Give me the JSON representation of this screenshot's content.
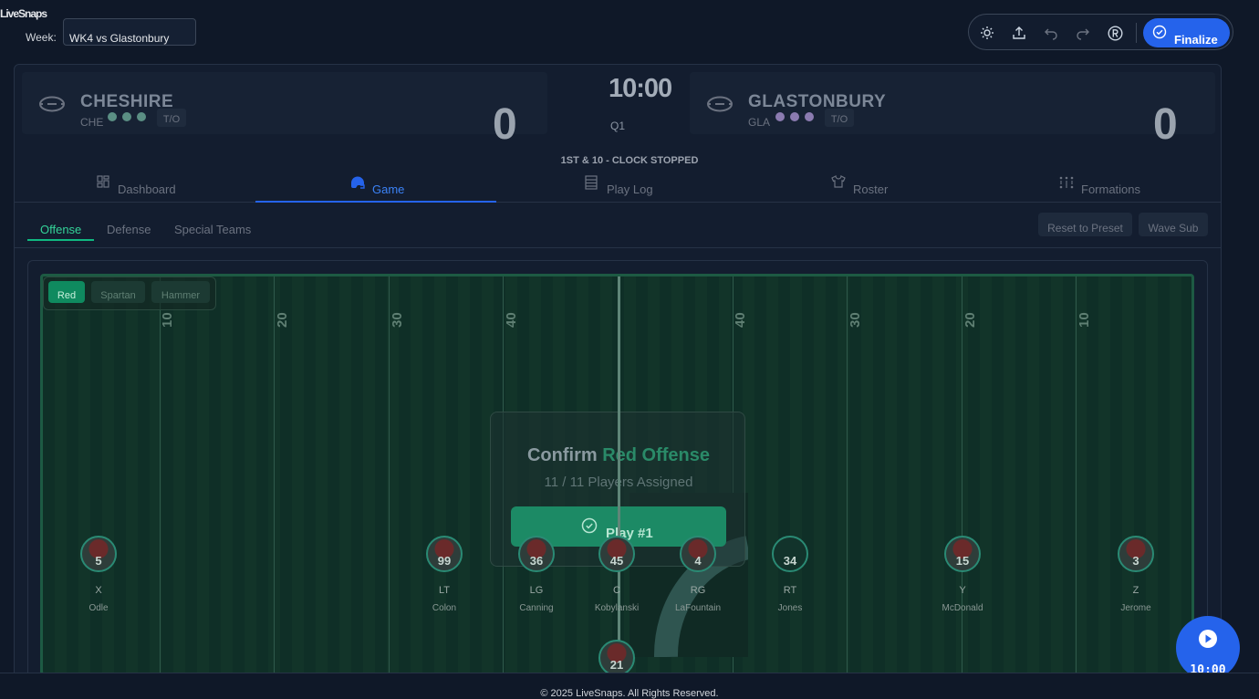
{
  "app": {
    "title": "LiveSnaps"
  },
  "week": {
    "label": "Week:",
    "value": "WK4 vs Glastonbury"
  },
  "toolbar": {
    "finalize_label": "Finalize"
  },
  "home": {
    "name": "CHESHIRE",
    "abbr": "CHE",
    "score": "0",
    "timeout_label": "T/O",
    "timeout_color": "#5b8f84"
  },
  "away": {
    "name": "GLASTONBURY",
    "abbr": "GLA",
    "score": "0",
    "timeout_label": "T/O",
    "timeout_color": "#8b7bb0"
  },
  "game_clock": "10:00",
  "quarter": "Q1",
  "down_distance": "1ST & 10 - CLOCK STOPPED",
  "tabs": [
    {
      "label": "Dashboard",
      "icon": "dashboard-icon"
    },
    {
      "label": "Game",
      "icon": "helmet-icon"
    },
    {
      "label": "Play Log",
      "icon": "log-icon"
    },
    {
      "label": "Roster",
      "icon": "jersey-icon"
    },
    {
      "label": "Formations",
      "icon": "formation-icon"
    }
  ],
  "active_tab": "Game",
  "units": [
    "Offense",
    "Defense",
    "Special Teams"
  ],
  "active_unit": "Offense",
  "actions": {
    "reset_label": "Reset to Preset",
    "wave_label": "Wave Sub"
  },
  "presets": [
    "Red",
    "Spartan",
    "Hammer"
  ],
  "active_preset": "Red",
  "yard_numbers": [
    "10",
    "20",
    "30",
    "40",
    "40",
    "30",
    "20",
    "10"
  ],
  "confirm": {
    "prefix": "Confirm",
    "accent": "Red Offense",
    "assigned": "11 / 11 Players Assigned",
    "button_label": "Play #1"
  },
  "players": [
    {
      "number": "5",
      "position": "X",
      "name": "Odle"
    },
    {
      "number": "99",
      "position": "LT",
      "name": "Colon"
    },
    {
      "number": "36",
      "position": "LG",
      "name": "Canning"
    },
    {
      "number": "45",
      "position": "C",
      "name": "Kobylanski"
    },
    {
      "number": "4",
      "position": "RG",
      "name": "LaFountain"
    },
    {
      "number": "34",
      "position": "RT",
      "name": "Jones"
    },
    {
      "number": "15",
      "position": "Y",
      "name": "McDonald"
    },
    {
      "number": "3",
      "position": "Z",
      "name": "Jerome"
    },
    {
      "number": "21",
      "position": "",
      "name": ""
    }
  ],
  "fab_time": "10:00",
  "footer": "© 2025 LiveSnaps. All Rights Reserved."
}
